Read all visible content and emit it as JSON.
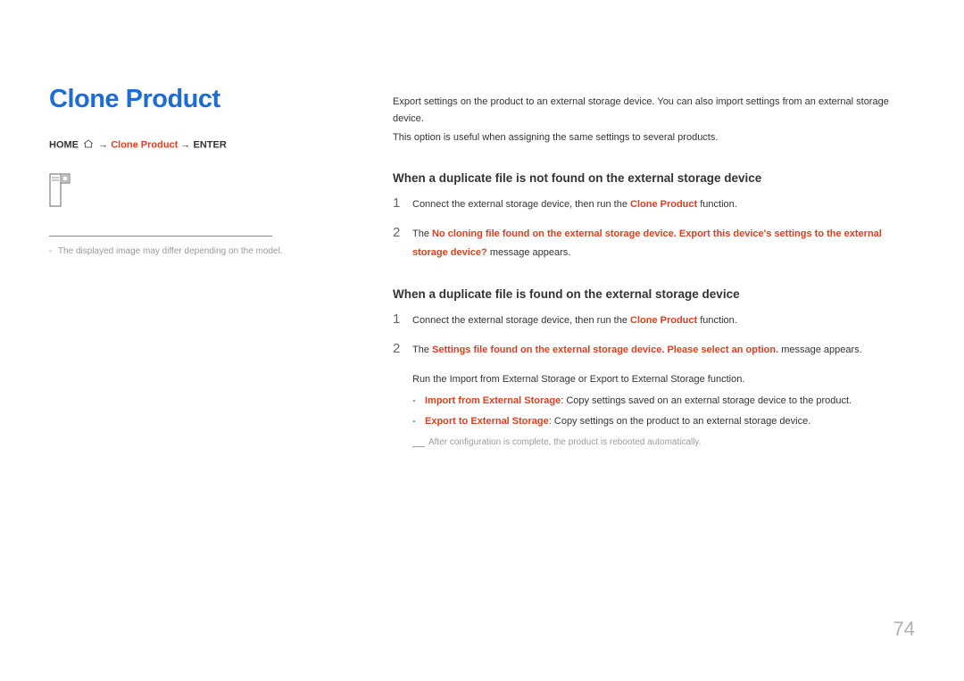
{
  "title": "Clone Product",
  "breadcrumb": {
    "home": "HOME",
    "arrow1": " → ",
    "clone_product": "Clone Product",
    "arrow2": " → ",
    "enter": "ENTER"
  },
  "footnote": "The displayed image may differ depending on the model.",
  "intro": {
    "line1": "Export settings on the product to an external storage device. You can also import settings from an external storage device.",
    "line2": "This option is useful when assigning the same settings to several products."
  },
  "section1": {
    "heading": "When a duplicate file is not found on the external storage device",
    "step1": {
      "num": "1",
      "text_before": "Connect the external storage device, then run the ",
      "highlight": "Clone Product",
      "text_after": " function."
    },
    "step2": {
      "num": "2",
      "text_before": "The ",
      "highlight": "No cloning file found on the external storage device. Export this device's settings to the external storage device?",
      "text_after": " message appears."
    }
  },
  "section2": {
    "heading": "When a duplicate file is found on the external storage device",
    "step1": {
      "num": "1",
      "text_before": "Connect the external storage device, then run the ",
      "highlight": "Clone Product",
      "text_after": " function."
    },
    "step2": {
      "num": "2",
      "text_before": "The ",
      "highlight": "Settings file found on the external storage device. Please select an option.",
      "text_after": " message appears."
    },
    "sub": {
      "text_before": "Run the ",
      "highlight1": "Import from External Storage",
      "text_mid": " or ",
      "highlight2": "Export to External Storage",
      "text_after": " function."
    },
    "bullet1": {
      "highlight": "Import from External Storage",
      "text": ": Copy settings saved on an external storage device to the product."
    },
    "bullet2": {
      "highlight": "Export to External Storage",
      "text": ": Copy settings on the product to an external storage device."
    },
    "note": "After configuration is complete, the product is rebooted automatically."
  },
  "page_number": "74"
}
